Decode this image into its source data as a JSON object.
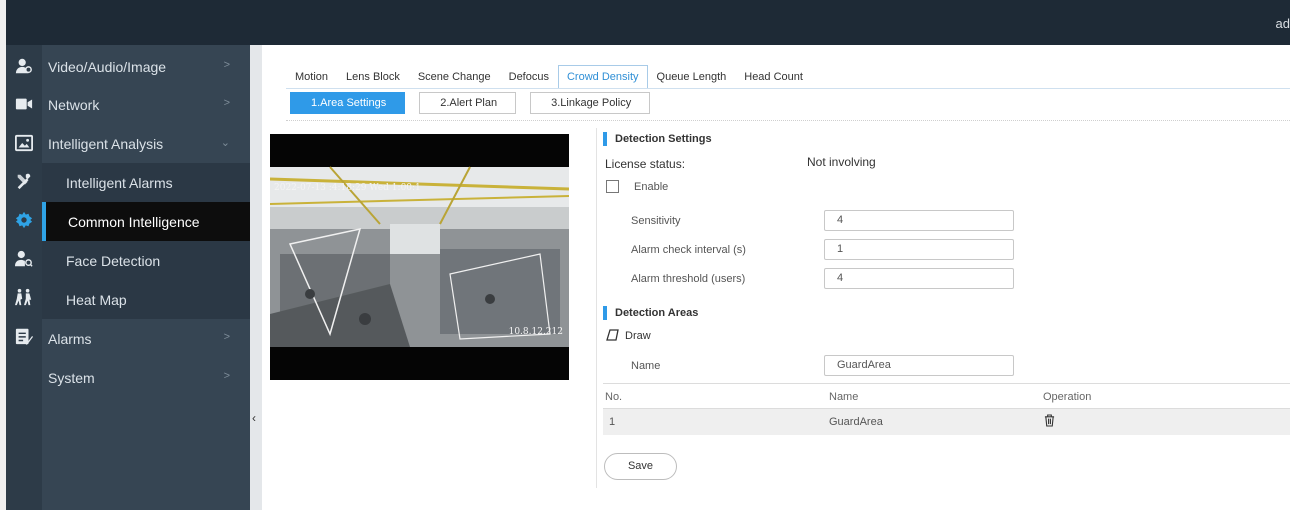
{
  "header": {
    "user": "ad"
  },
  "nav_icons": [
    "user-settings-icon",
    "video-camera-icon",
    "image-icon",
    "tools-icon",
    "gear-icon",
    "person-search-icon",
    "people-walking-icon",
    "checklist-icon"
  ],
  "sidebar": {
    "items": [
      {
        "label": "Video/Audio/Image",
        "chevron": ">"
      },
      {
        "label": "Network",
        "chevron": ">"
      },
      {
        "label": "Intelligent Analysis",
        "chevron": "v"
      },
      {
        "label": "Intelligent Alarms"
      },
      {
        "label": "Common Intelligence"
      },
      {
        "label": "Face Detection"
      },
      {
        "label": "Heat Map"
      },
      {
        "label": "Alarms",
        "chevron": ">"
      },
      {
        "label": "System",
        "chevron": ">"
      }
    ],
    "collapse_arrow": "‹"
  },
  "tabs": [
    "Motion",
    "Lens Block",
    "Scene Change",
    "Defocus",
    "Crowd Density",
    "Queue Length",
    "Head Count"
  ],
  "active_tab": "Crowd Density",
  "steps": [
    "1.Area Settings",
    "2.Alert Plan",
    "3.Linkage Policy"
  ],
  "video": {
    "timestamp": "2022-07-13 :4:18:29 Wed 1:00:1",
    "ip": "10.8.12.212"
  },
  "detection_settings": {
    "title": "Detection Settings",
    "license_label": "License status:",
    "license_value": "Not involving",
    "enable_label": "Enable",
    "enabled": false,
    "sensitivity_label": "Sensitivity",
    "sensitivity_value": "4",
    "interval_label": "Alarm check interval (s)",
    "interval_value": "1",
    "threshold_label": "Alarm threshold (users)",
    "threshold_value": "4"
  },
  "detection_areas": {
    "title": "Detection Areas",
    "draw_label": "Draw",
    "name_label": "Name",
    "name_value": "GuardArea",
    "columns": [
      "No.",
      "Name",
      "Operation"
    ],
    "rows": [
      {
        "no": "1",
        "name": "GuardArea"
      }
    ]
  },
  "save_label": "Save",
  "colors": {
    "accent": "#2f9ae8",
    "sidebar": "#364553",
    "topbar": "#1e2a36",
    "active_item": "#0d0d0d"
  }
}
